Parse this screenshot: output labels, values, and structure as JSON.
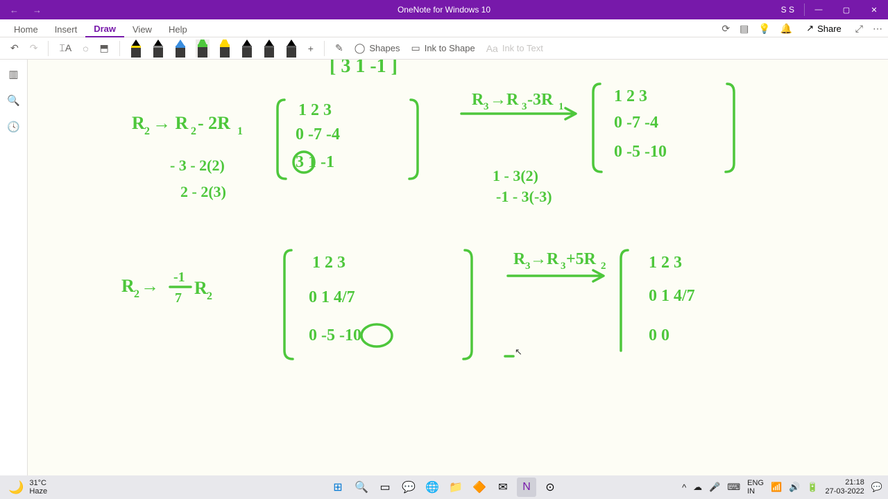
{
  "titlebar": {
    "app_title": "OneNote for Windows 10",
    "user": "S S"
  },
  "tabs": {
    "home": "Home",
    "insert": "Insert",
    "draw": "Draw",
    "view": "View",
    "help": "Help",
    "share": "Share"
  },
  "toolbar": {
    "shapes": "Shapes",
    "ink_to_shape": "Ink to Shape",
    "ink_to_text": "Ink to Text"
  },
  "weather": {
    "temp": "31°C",
    "condition": "Haze"
  },
  "tray": {
    "lang1": "ENG",
    "lang2": "IN",
    "time": "21:18",
    "date": "27-03-2022"
  },
  "ink_content": {
    "top_fragment": "[3   1  -1]",
    "row_op_1": "R₂ → R₂ - 2R₁",
    "calc_1a": "- 3 - 2(2)",
    "calc_1b": "2 - 2(3)",
    "row_op_2": "R₃ → R₃ - 3R₁",
    "calc_2a": "1 - 3(2)",
    "calc_2b": "-1 - 3(-3)",
    "row_op_3": "R₂ → -1/7 R₂",
    "row_op_4": "R₃ → R₃ + 5R₂",
    "matrix_1": {
      "r1": "1   2   3",
      "r2": "0  -7  -4",
      "r3": "3   1  -1",
      "circled": "3"
    },
    "matrix_2": {
      "r1": "1   2   3",
      "r2": "0  -7  -4",
      "r3": "0  -5  -10"
    },
    "matrix_3": {
      "r1": "1   2   3",
      "r2": "0   1   4/7",
      "r3": "0  -5  -10",
      "circled": "-5"
    },
    "matrix_4": {
      "r1": "1   2   3",
      "r2": "0   1   4/7",
      "r3": "0   0"
    }
  }
}
